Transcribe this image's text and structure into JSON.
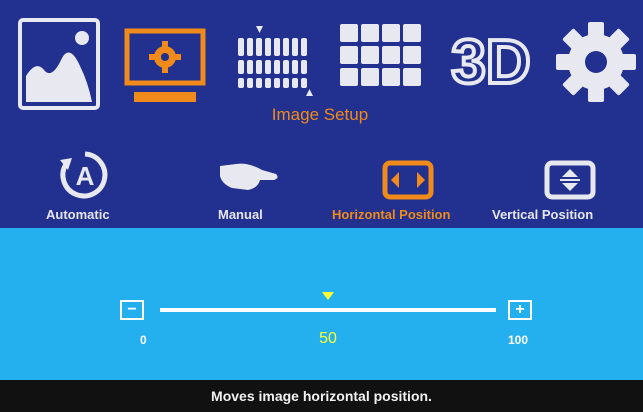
{
  "tabs": [
    {
      "icon": "picture-icon",
      "active": false
    },
    {
      "icon": "monitor-gear-icon",
      "active": true
    },
    {
      "icon": "pixel-phase-icon",
      "active": false
    },
    {
      "icon": "grid-icon",
      "active": false
    },
    {
      "icon": "3d-icon",
      "active": false
    },
    {
      "icon": "gear-icon",
      "active": false
    }
  ],
  "tab_3d_text": "3D",
  "section_title": "Image Setup",
  "subitems": [
    {
      "label": "Automatic",
      "icon": "auto-adjust-icon",
      "active": false
    },
    {
      "label": "Manual",
      "icon": "hand-icon",
      "active": false
    },
    {
      "label": "Horizontal Position",
      "icon": "horizontal-position-icon",
      "active": true
    },
    {
      "label": "Vertical Position",
      "icon": "vertical-position-icon",
      "active": false
    }
  ],
  "slider": {
    "min_label": "0",
    "max_label": "100",
    "value_label": "50",
    "value": 50,
    "decrement_symbol": "−",
    "increment_symbol": "+"
  },
  "status_text": "Moves image horizontal position.",
  "colors": {
    "accent": "#f08a1a",
    "highlight": "#ffff33",
    "panel": "#24b0ee",
    "header": "#22308f"
  }
}
